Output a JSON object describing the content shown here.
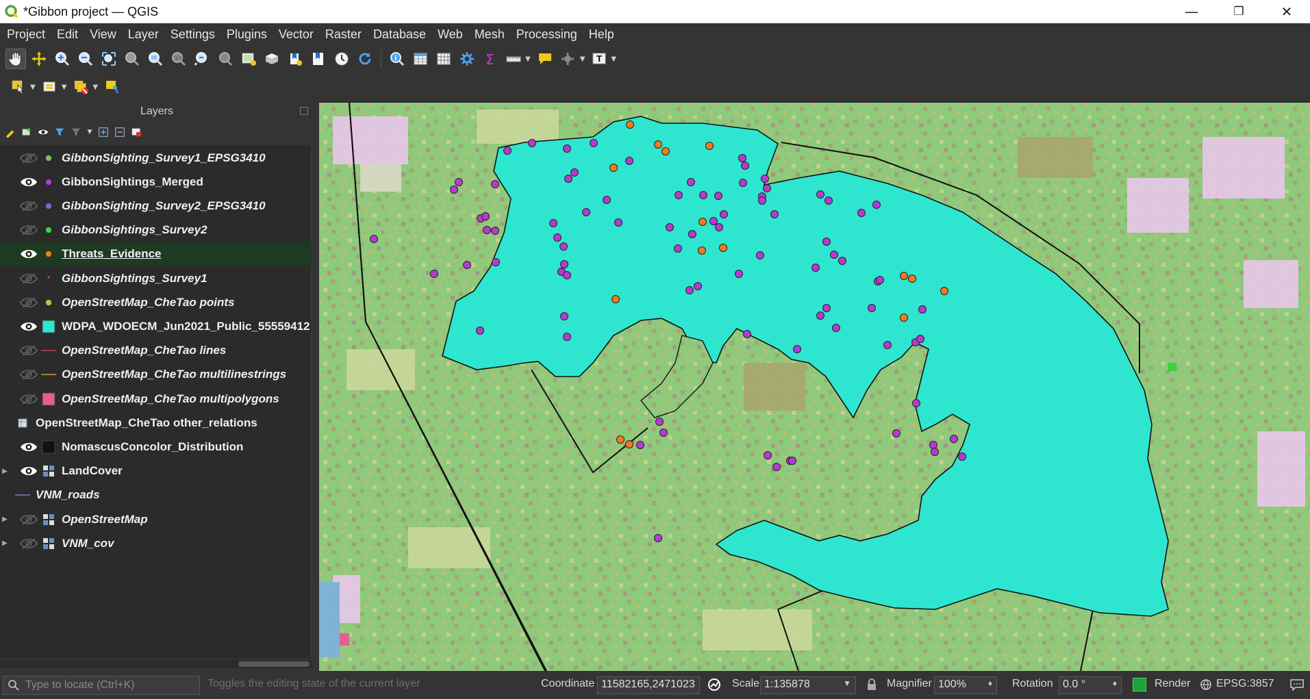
{
  "window": {
    "title": "*Gibbon project — QGIS",
    "controls": {
      "minimize": "—",
      "restore": "❐",
      "close": "✕"
    }
  },
  "menubar": [
    "Project",
    "Edit",
    "View",
    "Layer",
    "Settings",
    "Plugins",
    "Vector",
    "Raster",
    "Database",
    "Web",
    "Mesh",
    "Processing",
    "Help"
  ],
  "layers_panel": {
    "title": "Layers",
    "layers": [
      {
        "name": "GibbonSighting_Survey1_EPSG3410",
        "visible": false,
        "italic": true,
        "symbol": "point",
        "color": "#7dbb63"
      },
      {
        "name": "GibbonSightings_Merged",
        "visible": true,
        "italic": false,
        "symbol": "point",
        "color": "#b63ad1"
      },
      {
        "name": "GibbonSighting_Survey2_EPSG3410",
        "visible": false,
        "italic": true,
        "symbol": "point",
        "color": "#6a6fd0"
      },
      {
        "name": "GibbonSightings_Survey2",
        "visible": false,
        "italic": true,
        "symbol": "point",
        "color": "#3ad33a"
      },
      {
        "name": "Threats_Evidence",
        "visible": true,
        "italic": false,
        "symbol": "point",
        "color": "#f07a1e",
        "selected": true
      },
      {
        "name": "GibbonSightings_Survey1",
        "visible": false,
        "italic": true,
        "symbol": "dot",
        "color": "#d6436b"
      },
      {
        "name": "OpenStreetMap_CheTao points",
        "visible": false,
        "italic": true,
        "symbol": "point",
        "color": "#b8c34f"
      },
      {
        "name": "WDPA_WDOECM_Jun2021_Public_55559412",
        "visible": true,
        "italic": false,
        "symbol": "fill",
        "color": "#2ee6cf"
      },
      {
        "name": "OpenStreetMap_CheTao lines",
        "visible": false,
        "italic": true,
        "symbol": "line",
        "color": "#c43b3b"
      },
      {
        "name": "OpenStreetMap_CheTao multilinestrings",
        "visible": false,
        "italic": true,
        "symbol": "line",
        "color": "#d6a02a"
      },
      {
        "name": "OpenStreetMap_CheTao multipolygons",
        "visible": false,
        "italic": true,
        "symbol": "fill",
        "color": "#e35f8c"
      },
      {
        "name": "OpenStreetMap_CheTao other_relations",
        "visible": null,
        "italic": false,
        "symbol": "table",
        "color": "#cccccc"
      },
      {
        "name": "NomascusConcolor_Distribution",
        "visible": true,
        "italic": false,
        "symbol": "fill",
        "color": "#111111"
      },
      {
        "name": "LandCover",
        "visible": true,
        "italic": false,
        "symbol": "raster",
        "color": "#9fb3d6",
        "expandable": true
      },
      {
        "name": "VNM_roads",
        "visible": null,
        "italic": true,
        "symbol": "line",
        "color": "#8e6fb8"
      },
      {
        "name": "OpenStreetMap",
        "visible": false,
        "italic": true,
        "symbol": "raster",
        "color": "#9fb3d6",
        "expandable": true
      },
      {
        "name": "VNM_cov",
        "visible": false,
        "italic": true,
        "symbol": "raster",
        "color": "#9fb3d6",
        "expandable": true
      }
    ]
  },
  "map": {
    "protected_area_color": "#2ee6cf",
    "landcover_base_color": "#8ec97c",
    "sighting_color": "#b63ad1",
    "threat_color": "#f07a1e"
  },
  "statusbar": {
    "locator_placeholder": "Type to locate (Ctrl+K)",
    "hint": "Toggles the editing state of the current layer",
    "coordinate_label": "Coordinate",
    "coordinate_value": "11582165,2471023",
    "scale_label": "Scale",
    "scale_value": "1:135878",
    "magnifier_label": "Magnifier",
    "magnifier_value": "100%",
    "rotation_label": "Rotation",
    "rotation_value": "0.0 °",
    "render_label": "Render",
    "crs": "EPSG:3857"
  }
}
